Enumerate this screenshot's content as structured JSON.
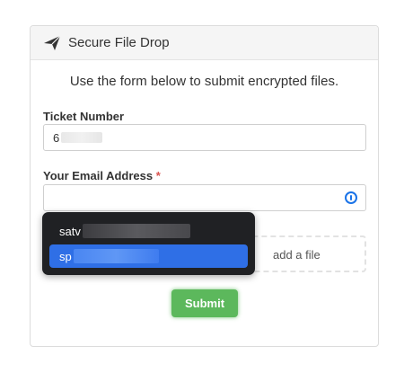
{
  "panel": {
    "title": "Secure File Drop",
    "icon": "paper-plane-icon",
    "intro": "Use the form below to submit encrypted files."
  },
  "form": {
    "ticket_label": "Ticket Number",
    "ticket_value": "6",
    "email_label": "Your Email Address",
    "email_required_marker": "*",
    "email_value": "",
    "dropzone_text": "add a file",
    "submit_label": "Submit"
  },
  "autofill": {
    "suggestions": [
      {
        "visible_prefix": "satv",
        "selected": false
      },
      {
        "visible_prefix": "sp",
        "selected": true
      }
    ]
  },
  "colors": {
    "submit": "#5cb85c",
    "required": "#d9534f",
    "autofill_bg": "#202124",
    "autofill_selected": "#2f6fe6",
    "password_manager_icon": "#1a73e8"
  }
}
